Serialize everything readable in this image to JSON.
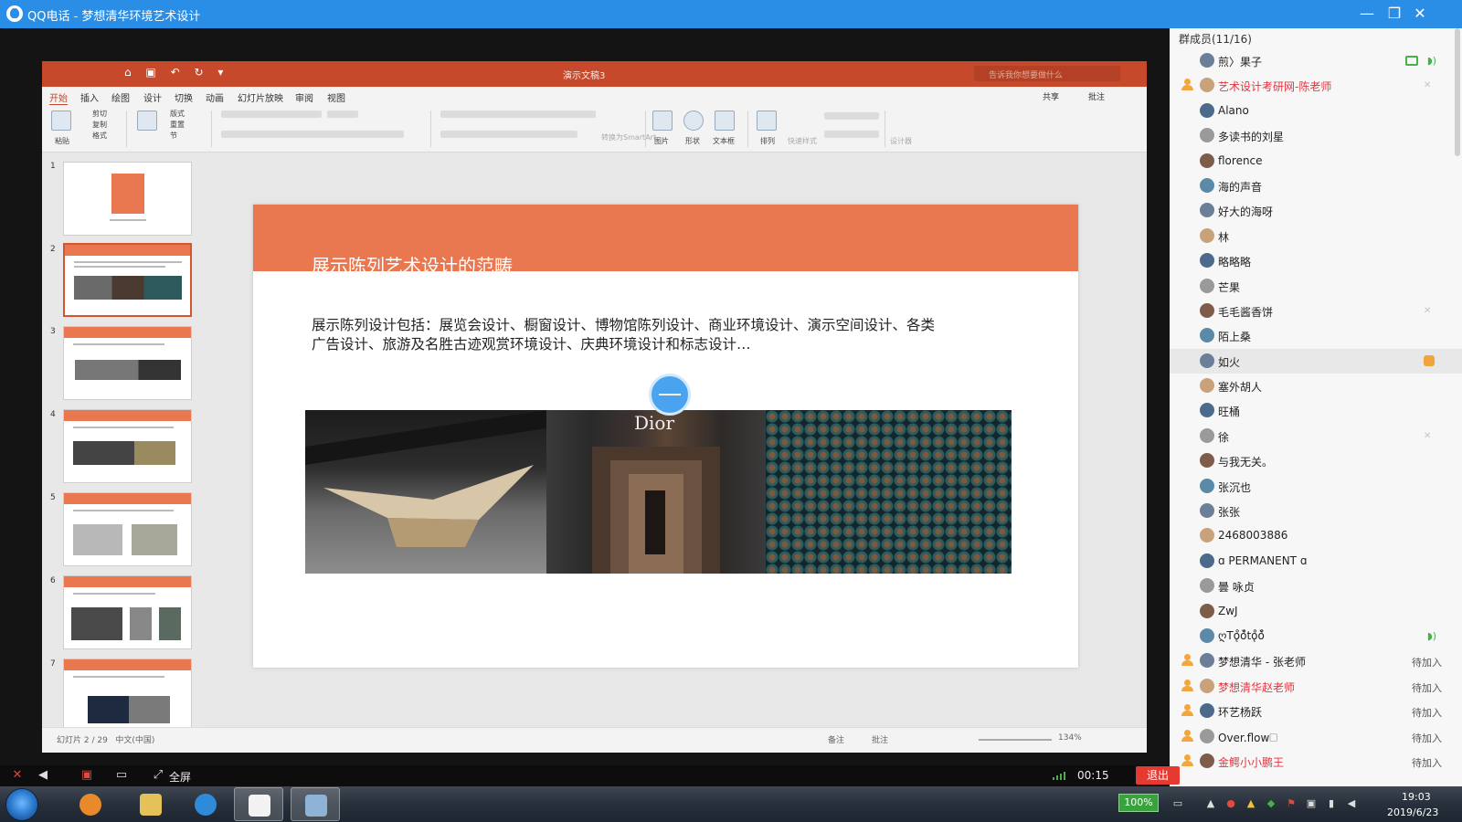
{
  "window": {
    "title": "QQ电话 - 梦想清华环境艺术设计",
    "minimize": "—",
    "restore": "❐",
    "close": "✕"
  },
  "ppt": {
    "doc_title": "演示文稿3",
    "search_placeholder": "告诉我你想要做什么",
    "menu": [
      "开始",
      "插入",
      "绘图",
      "设计",
      "切换",
      "动画",
      "幻灯片放映",
      "审阅",
      "视图"
    ],
    "share_label": "共享",
    "comment_label": "批注",
    "ribbon": {
      "paste": "粘贴",
      "cut": "剪切",
      "copy": "复制",
      "format": "格式",
      "new_slide": "新建\n幻灯片",
      "layout": "版式",
      "reset": "重置",
      "section": "节",
      "picture": "图片",
      "shape": "形状",
      "textbox": "文本框",
      "arrange": "排列",
      "smartart": "转换为SmartArt",
      "quick_style": "快速样式",
      "design": "设计器"
    },
    "thumbnail_numbers": [
      "1",
      "2",
      "3",
      "4",
      "5",
      "6",
      "7"
    ],
    "slide": {
      "title": "展示陈列艺术设计的范畴",
      "body": "展示陈列设计包括：展览会设计、橱窗设计、博物馆陈列设计、商业环境设计、演示空间设计、各类广告设计、旅游及名胜古迹观赏环境设计、庆典环境设计和标志设计…",
      "photo_logo": "Dior"
    },
    "status": {
      "slide_indicator": "幻灯片 2 / 29",
      "language": "中文(中国)",
      "notes": "备注",
      "comments": "批注",
      "zoom": "134%"
    }
  },
  "members": {
    "header": "群成员(11/16)",
    "list": [
      {
        "name": "煎〉果子",
        "role": false,
        "red": false,
        "icons": [
          "screen",
          "speak"
        ],
        "status": ""
      },
      {
        "name": "艺术设计考研网-陈老师",
        "role": true,
        "red": true,
        "icons": [
          "mute"
        ],
        "status": ""
      },
      {
        "name": "Alano",
        "role": false,
        "red": false,
        "icons": [],
        "status": ""
      },
      {
        "name": "多读书的刘星",
        "role": false,
        "red": false,
        "icons": [],
        "status": ""
      },
      {
        "name": "florence",
        "role": false,
        "red": false,
        "icons": [],
        "status": ""
      },
      {
        "name": "海的声音",
        "role": false,
        "red": false,
        "icons": [],
        "status": ""
      },
      {
        "name": "好大的海呀",
        "role": false,
        "red": false,
        "icons": [],
        "status": ""
      },
      {
        "name": "林",
        "role": false,
        "red": false,
        "icons": [],
        "status": ""
      },
      {
        "name": "略略略",
        "role": false,
        "red": false,
        "icons": [],
        "status": ""
      },
      {
        "name": "芒果",
        "role": false,
        "red": false,
        "icons": [],
        "status": ""
      },
      {
        "name": "毛毛酱香饼",
        "role": false,
        "red": false,
        "icons": [
          "mute"
        ],
        "status": ""
      },
      {
        "name": "陌上桑",
        "role": false,
        "red": false,
        "icons": [],
        "status": ""
      },
      {
        "name": "如火",
        "role": false,
        "red": false,
        "icons": [
          "hand"
        ],
        "status": "",
        "hover": true
      },
      {
        "name": "塞外胡人",
        "role": false,
        "red": false,
        "icons": [],
        "status": ""
      },
      {
        "name": "旺桶",
        "role": false,
        "red": false,
        "icons": [],
        "status": ""
      },
      {
        "name": "徐",
        "role": false,
        "red": false,
        "icons": [
          "mute"
        ],
        "status": ""
      },
      {
        "name": "与我无关。",
        "role": false,
        "red": false,
        "icons": [],
        "status": ""
      },
      {
        "name": "张沉也",
        "role": false,
        "red": false,
        "icons": [],
        "status": ""
      },
      {
        "name": "张张",
        "role": false,
        "red": false,
        "icons": [],
        "status": ""
      },
      {
        "name": "2468003886",
        "role": false,
        "red": false,
        "icons": [],
        "status": ""
      },
      {
        "name": "ɑ PERMANENT ɑ",
        "role": false,
        "red": false,
        "icons": [],
        "status": ""
      },
      {
        "name": "曇 咏贞",
        "role": false,
        "red": false,
        "icons": [],
        "status": ""
      },
      {
        "name": "ZwJ",
        "role": false,
        "red": false,
        "icons": [],
        "status": ""
      },
      {
        "name": "ღTǫ̊ǒ̊tǫ̊ǒ̊",
        "role": false,
        "red": false,
        "icons": [
          "speak"
        ],
        "status": ""
      },
      {
        "name": "梦想清华 - 张老师",
        "role": true,
        "red": false,
        "icons": [],
        "status": "待加入"
      },
      {
        "name": "梦想清华赵老师",
        "role": true,
        "red": true,
        "icons": [],
        "status": "待加入"
      },
      {
        "name": "环艺杨跃",
        "role": true,
        "red": false,
        "icons": [],
        "status": "待加入"
      },
      {
        "name": "Over.flow🗆",
        "role": true,
        "red": false,
        "icons": [],
        "status": "待加入"
      },
      {
        "name": "金鳄小小鹏王",
        "role": true,
        "red": true,
        "icons": [],
        "status": "待加入"
      }
    ]
  },
  "call_bar": {
    "fullscreen": "全屏",
    "time": "00:15",
    "exit": "退出"
  },
  "taskbar": {
    "battery": "100%",
    "time": "19:03",
    "date": "2019/6/23"
  },
  "colors": {
    "qq_blue": "#2b8ee6",
    "ppt_orange": "#c5492a",
    "slide_header": "#e9774f",
    "exit_red": "#e53a32"
  }
}
